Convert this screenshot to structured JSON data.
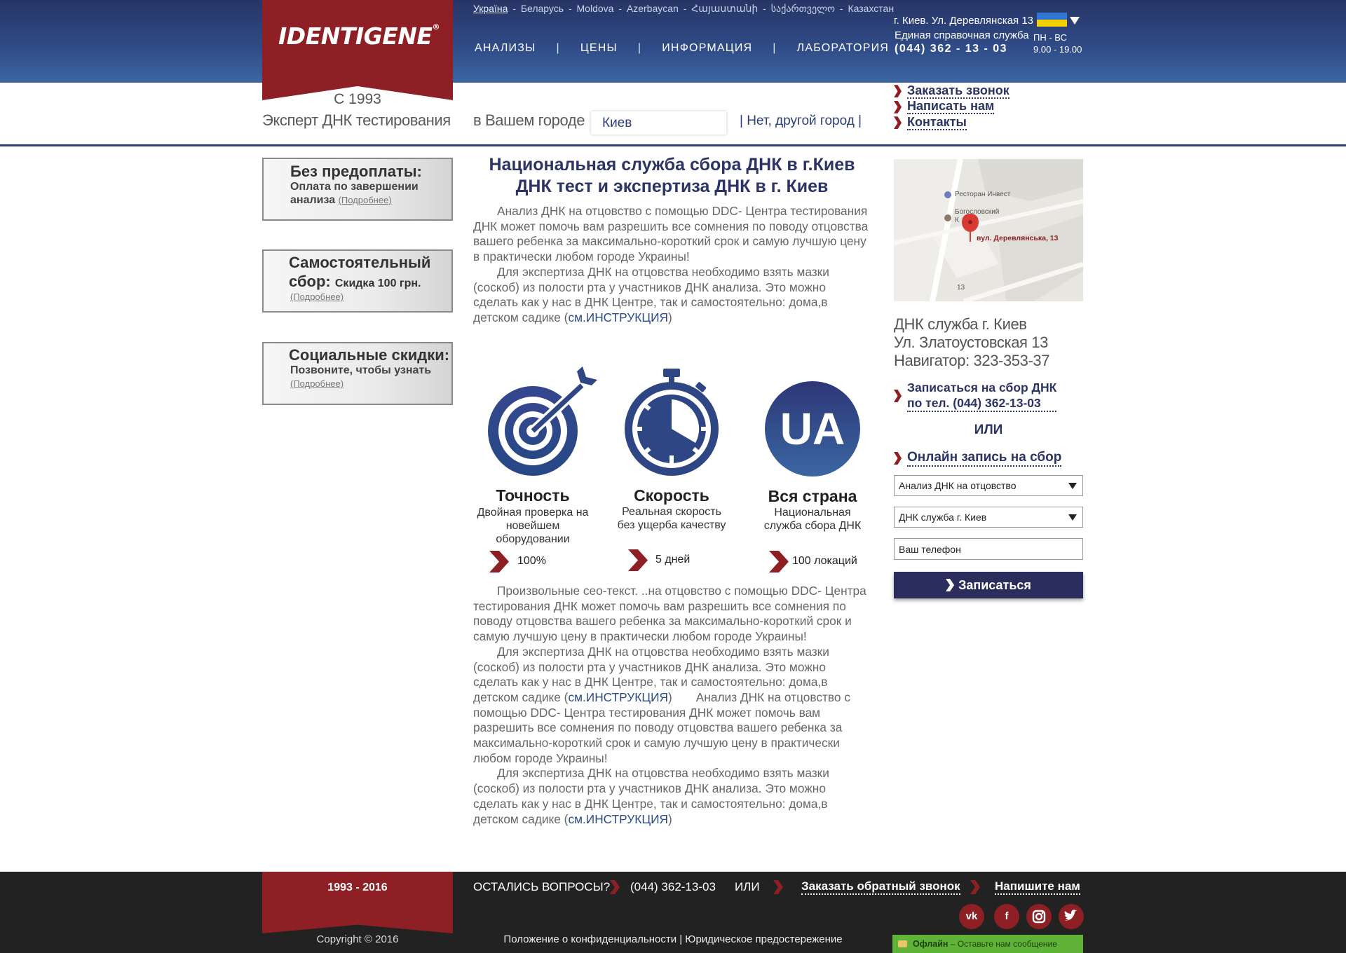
{
  "logo": {
    "text": "IDENTIGENE",
    "reg": "®"
  },
  "countries": [
    "Україна",
    "Беларусь",
    "Moldova",
    "Azerbaycan",
    "Հայաստանի",
    "საქართველო",
    "Казахстан"
  ],
  "nav": [
    "АНАЛИЗЫ",
    "ЦЕНЫ",
    "ИНФОРМАЦИЯ",
    "ЛАБОРАТОРИЯ"
  ],
  "nav_sep": "|",
  "header_contact": {
    "address": "г. Киев. Ул. Деревлянская 13",
    "service": "Единая справочная служба",
    "phone": "(044)  362 - 13 - 03",
    "days": "ПН  -  ВС",
    "hours": "9.00 - 19.00"
  },
  "since": "С 1993",
  "tagline": "Эксперт ДНК тестирования",
  "city": {
    "label": "в Вашем городе",
    "value": "Киев",
    "other": "| Нет, другой город |"
  },
  "quick_links": [
    "Заказать звонок",
    "Написать нам",
    "Контакты"
  ],
  "promos": [
    {
      "title": "Без предоплаты:",
      "sub1": "Оплата по завершении",
      "sub2": "анализа",
      "more": "(Подробнее)"
    },
    {
      "title": "Самостоятельный",
      "title2": "сбор:",
      "sub_inline": "Скидка 100 грн.",
      "more": "(Подробнее)"
    },
    {
      "title": "Социальные скидки:",
      "sub1": "Позвоните, чтобы узнать",
      "more": "(Подробнее)"
    }
  ],
  "main": {
    "title1": "Национальная служба сбора ДНК в г.Киев",
    "title2": "ДНК тест и экспертиза ДНК в г. Киев",
    "p1": "Анализ ДНК на отцовство с помощью DDC- Центра тестирования ДНК может помочь вам разрешить все сомнения по поводу отцовства вашего ребенка за максимально-короткий срок и самую лучшую цену в практически любом городе Украины!",
    "p2": "Для экспертиза ДНК на отцовства необходимо взять мазки (соскоб) из полости рта у участников ДНК анализа. Это можно сделать как у нас в ДНК Центре, так и самостоятельно: дома,в детском садике (",
    "instr_link": "см.ИНСТРУКЦИЯ",
    "close_paren": ")",
    "p3": "Произвольные сео-текст. ..на отцовство с помощью DDC- Центра тестирования ДНК может помочь вам разрешить все сомнения по поводу отцовства вашего ребенка за максимально-короткий срок и самую лучшую цену в практически любом городе Украины!",
    "p4a": "Для экспертиза ДНК на отцовства необходимо взять мазки (соскоб) из полости рта у участников ДНК анализа. Это можно сделать как у нас в ДНК Центре, так и самостоятельно: дома,в детском садике (",
    "p4b": "Анализ ДНК на отцовство с помощью DDC- Центра тестирования ДНК может помочь вам разрешить все сомнения по поводу отцовства вашего ребенка за максимально-короткий срок и самую лучшую цену в практически любом городе Украины!",
    "p5": "Для экспертиза ДНК на отцовства необходимо взять мазки (соскоб) из полости рта у участников ДНК анализа. Это можно сделать как у нас в ДНК Центре, так и самостоятельно: дома,в детском садике ("
  },
  "features": [
    {
      "icon": "target-icon",
      "title": "Точность",
      "desc1": "Двойная проверка на",
      "desc2": "новейшем",
      "desc3": "оборудовании",
      "stat": "100%"
    },
    {
      "icon": "stopwatch-icon",
      "title": "Скорость",
      "desc1": "Реальная скорость",
      "desc2": "без ущерба качеству",
      "stat": "5 дней"
    },
    {
      "icon": "ua-badge-icon",
      "badge": "UA",
      "title": "Вся страна",
      "desc1": "Национальная",
      "desc2": "служба сбора ДНК",
      "stat": "100 локаций"
    }
  ],
  "map": {
    "poi1": "Ресторан Инвест",
    "poi2a": "Богословский",
    "poi2b": "К",
    "address": "вул. Деревлянська, 13",
    "number": "13"
  },
  "office": {
    "line1": "ДНК служба г. Киев",
    "line2": "Ул. Златоустовская 13",
    "line3": "Навигатор: 323-353-37"
  },
  "signup": {
    "phone_line1": "Записаться на сбор ДНК",
    "phone_line2": "по тел. (044) 362-13-03",
    "or": "ИЛИ",
    "online": "Онлайн запись на сбор",
    "select1": "Анализ ДНК на отцовство",
    "select2": "ДНК служба г. Киев",
    "phone_placeholder": "Ваш телефон",
    "submit": "Записаться"
  },
  "footer": {
    "years": "1993  -  2016",
    "copyright": "Copyright © 2016",
    "questions": "ОСТАЛИСЬ ВОПРОСЫ?",
    "phone": "(044) 362-13-03",
    "or": "ИЛИ",
    "callback": "Заказать обратный звонок",
    "write": "Напишите нам",
    "legal": "Положение о конфиденциальности | Юридическое предостережение",
    "social": [
      "vk-icon",
      "facebook-icon",
      "instagram-icon",
      "twitter-icon"
    ],
    "chat_status": "Офлайн",
    "chat_msg": "– Оставьте нам сообщение"
  },
  "colors": {
    "brand_red": "#8e1f24",
    "navy": "#2c3466",
    "header_blue": "#2f4a86",
    "chat_green": "#5fb336"
  }
}
